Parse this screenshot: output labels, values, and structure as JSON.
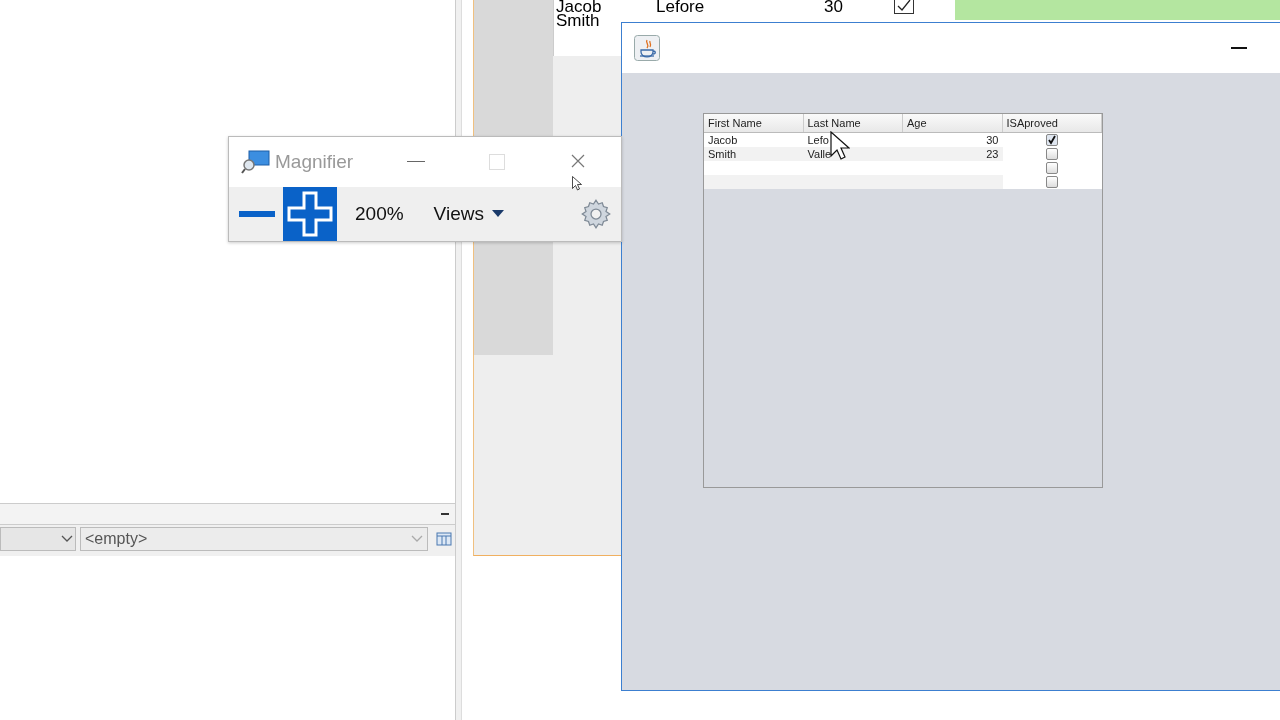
{
  "background_editor": {
    "table_rows": [
      {
        "first_name": "Jacob",
        "last_name": "Lefore",
        "age": "30",
        "checked": true
      },
      {
        "first_name": "Smith"
      }
    ],
    "property_panel": {
      "combo_value": "<empty>"
    }
  },
  "java_window": {
    "table": {
      "columns": [
        "First Name",
        "Last Name",
        "Age",
        "ISAproved"
      ],
      "rows": [
        {
          "first_name": "Jacob",
          "last_name": "Lefo",
          "age": "30",
          "approved": true
        },
        {
          "first_name": "Smith",
          "last_name": "Valle",
          "age": "23",
          "approved": false
        },
        {
          "approved": false
        },
        {
          "approved": false
        }
      ]
    }
  },
  "magnifier": {
    "title": "Magnifier",
    "zoom": "200%",
    "views": "Views"
  }
}
